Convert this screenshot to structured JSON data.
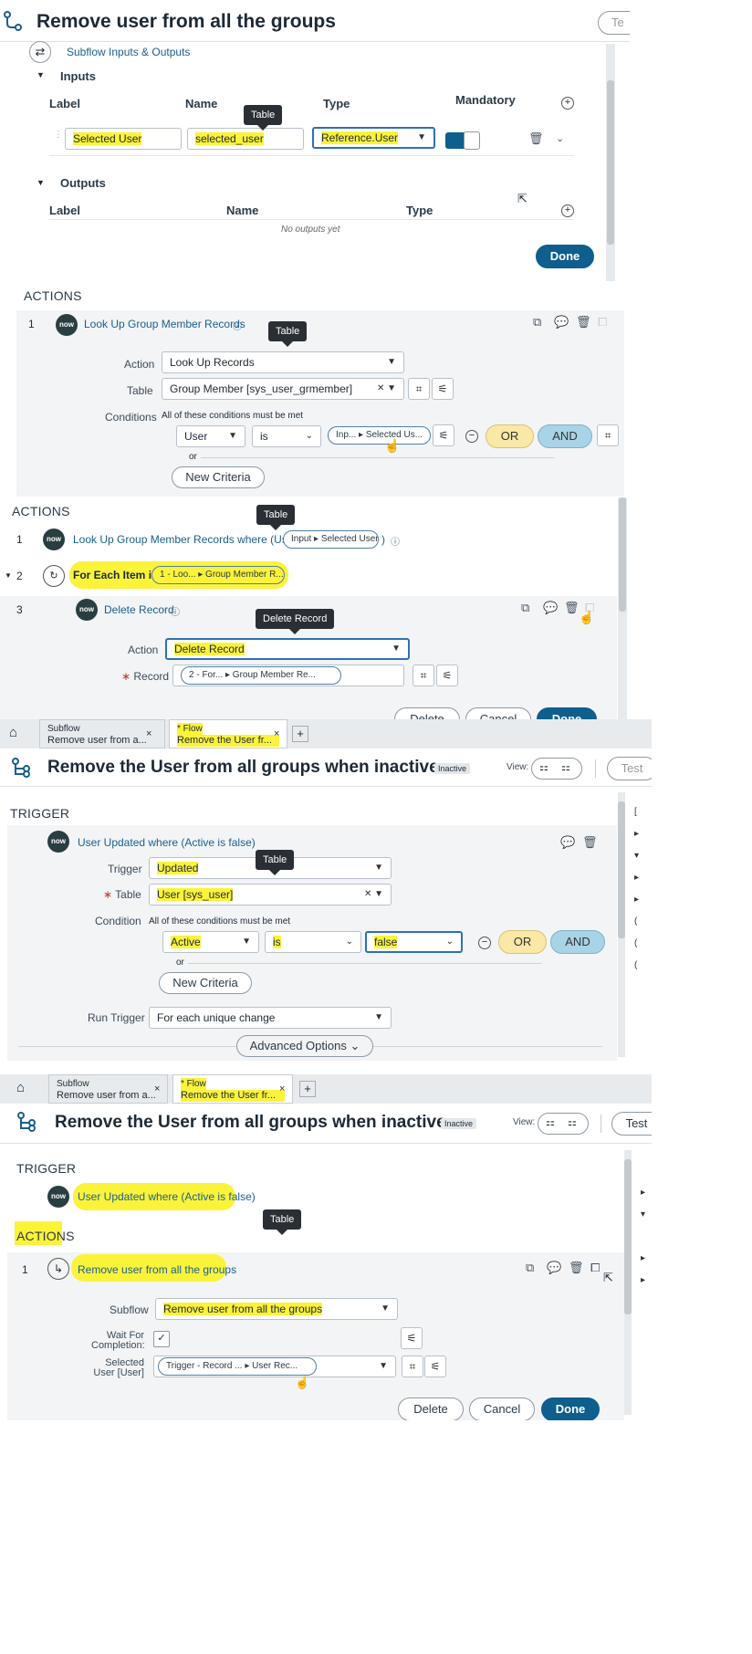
{
  "p1": {
    "title": "Remove user from all the groups",
    "test_btn": "Te",
    "subflow_io": "Subflow Inputs & Outputs",
    "inputs_label": "Inputs",
    "outputs_label": "Outputs",
    "cols": {
      "label": "Label",
      "name": "Name",
      "type": "Type",
      "mandatory": "Mandatory"
    },
    "input_row": {
      "label": "Selected User",
      "name": "selected_user",
      "type": "Reference.User"
    },
    "no_outputs": "No outputs yet",
    "done": "Done",
    "tooltip": "Table"
  },
  "p2": {
    "actions": "ACTIONS",
    "step_num": "1",
    "step_title": "Look Up Group Member Records",
    "tooltip": "Table",
    "action_lbl": "Action",
    "action_val": "Look Up Records",
    "table_lbl": "Table",
    "table_val": "Group Member [sys_user_grmember]",
    "cond_lbl": "Conditions",
    "cond_hint": "All of these conditions must be met",
    "cond_field": "User",
    "cond_op": "is",
    "cond_pill": "Inp... ▸ Selected Us...",
    "or": "OR",
    "and": "AND",
    "or_small": "or",
    "new_criteria": "New Criteria"
  },
  "p3": {
    "actions": "ACTIONS",
    "tooltip": "Table",
    "s1_num": "1",
    "s1_text": "Look Up Group Member Records where (User is",
    "s1_pill": "Input ▸ Selected User",
    "s1_end": ")",
    "s2_num": "2",
    "s2_text": "For Each Item in",
    "s2_pill": "1 - Loo... ▸ Group Member R...",
    "s3_num": "3",
    "s3_text": "Delete Record",
    "tooltip2": "Delete Record",
    "action_lbl": "Action",
    "action_val": "Delete Record",
    "record_lbl": "Record",
    "record_pill": "2 - For... ▸ Group Member Re...",
    "delete": "Delete",
    "cancel": "Cancel",
    "done": "Done"
  },
  "p4": {
    "tab1_type": "Subflow",
    "tab1_name": "Remove user from a...",
    "tab2_type": "* Flow",
    "tab2_name": "Remove the User fr...",
    "title": "Remove the User from all groups when inactive",
    "status": "Inactive",
    "view": "View:",
    "test": "Test",
    "trigger": "TRIGGER",
    "trigger_title": "User Updated where (Active is false)",
    "tooltip": "Table",
    "trigger_lbl": "Trigger",
    "trigger_val": "Updated",
    "table_lbl": "Table",
    "table_val": "User [sys_user]",
    "cond_lbl": "Condition",
    "cond_hint": "All of these conditions must be met",
    "cond_field": "Active",
    "cond_op": "is",
    "cond_val": "false",
    "or": "OR",
    "and": "AND",
    "or_small": "or",
    "new_criteria": "New Criteria",
    "run_lbl": "Run Trigger",
    "run_val": "For each unique change",
    "advanced": "Advanced Options"
  },
  "p5": {
    "tab1_type": "Subflow",
    "tab1_name": "Remove user from a...",
    "tab2_type": "* Flow",
    "tab2_name": "Remove the User fr...",
    "title": "Remove the User from all groups when inactive",
    "status": "Inactive",
    "view": "View:",
    "test": "Test",
    "trigger": "TRIGGER",
    "trigger_title": "User Updated where (Active is false)",
    "tooltip": "Table",
    "actions": "ACTIONS",
    "step_num": "1",
    "step_title": "Remove user from all the groups",
    "subflow_lbl": "Subflow",
    "subflow_val": "Remove user from all the groups",
    "wait_lbl1": "Wait For",
    "wait_lbl2": "Completion:",
    "sel_lbl1": "Selected",
    "sel_lbl2": "User [User]",
    "sel_pill": "Trigger - Record ... ▸ User Rec...",
    "delete": "Delete",
    "cancel": "Cancel",
    "done": "Done"
  }
}
